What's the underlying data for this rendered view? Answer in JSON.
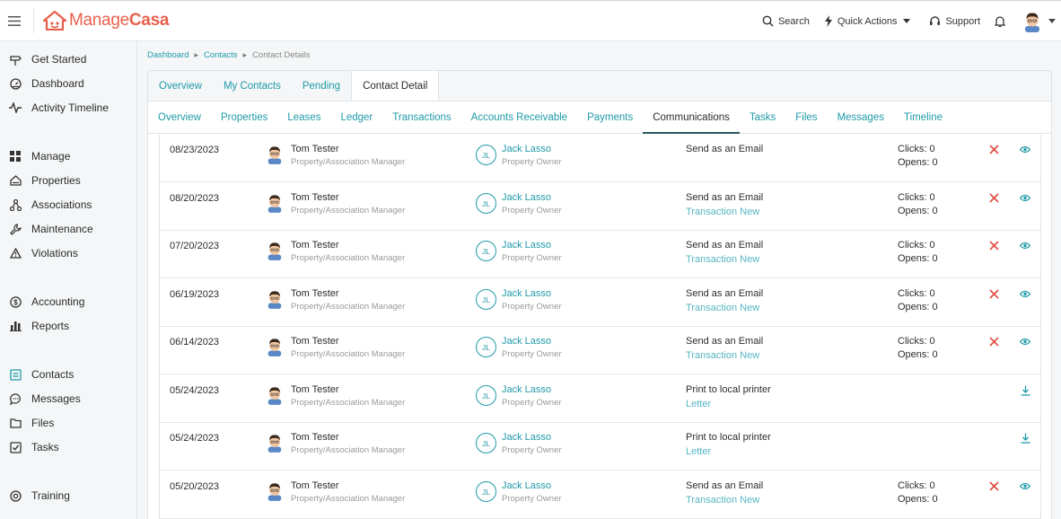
{
  "app": {
    "logo_part1": "Manage",
    "logo_part2": "Casa"
  },
  "topnav": {
    "search": "Search",
    "quick_actions": "Quick Actions",
    "support": "Support"
  },
  "sidebar": {
    "items": [
      {
        "label": "Get Started",
        "icon": "signpost-icon"
      },
      {
        "label": "Dashboard",
        "icon": "gauge-icon"
      },
      {
        "label": "Activity Timeline",
        "icon": "pulse-icon"
      },
      {
        "label": "Manage",
        "icon": "grid-icon"
      },
      {
        "label": "Properties",
        "icon": "home-icon"
      },
      {
        "label": "Associations",
        "icon": "network-icon"
      },
      {
        "label": "Maintenance",
        "icon": "wrench-icon"
      },
      {
        "label": "Violations",
        "icon": "warning-icon"
      },
      {
        "label": "Accounting",
        "icon": "dollar-icon"
      },
      {
        "label": "Reports",
        "icon": "bar-chart-icon"
      },
      {
        "label": "Contacts",
        "icon": "contacts-icon"
      },
      {
        "label": "Messages",
        "icon": "chat-icon"
      },
      {
        "label": "Files",
        "icon": "folder-icon"
      },
      {
        "label": "Tasks",
        "icon": "checkbox-icon"
      },
      {
        "label": "Training",
        "icon": "lifebuoy-icon"
      }
    ]
  },
  "breadcrumb": {
    "items": [
      "Dashboard",
      "Contacts",
      "Contact Details"
    ]
  },
  "tabs_primary": {
    "items": [
      "Overview",
      "My Contacts",
      "Pending",
      "Contact Detail"
    ],
    "active_index": 3
  },
  "tabs_secondary": {
    "items": [
      "Overview",
      "Properties",
      "Leases",
      "Ledger",
      "Transactions",
      "Accounts Receivable",
      "Payments",
      "Communications",
      "Tasks",
      "Files",
      "Messages",
      "Timeline"
    ],
    "active_index": 7
  },
  "communications": [
    {
      "date": "08/23/2023",
      "user": "Tom Tester",
      "user_role": "Property/Association Manager",
      "initials": "JL",
      "contact": "Jack Lasso",
      "contact_role": "Property Owner",
      "method": "Send as an Email",
      "subject": "",
      "clicks": "Clicks: 0",
      "opens": "Opens: 0",
      "action": "email"
    },
    {
      "date": "08/20/2023",
      "user": "Tom Tester",
      "user_role": "Property/Association Manager",
      "initials": "JL",
      "contact": "Jack Lasso",
      "contact_role": "Property Owner",
      "method": "Send as an Email",
      "subject": "Transaction New",
      "clicks": "Clicks: 0",
      "opens": "Opens: 0",
      "action": "email"
    },
    {
      "date": "07/20/2023",
      "user": "Tom Tester",
      "user_role": "Property/Association Manager",
      "initials": "JL",
      "contact": "Jack Lasso",
      "contact_role": "Property Owner",
      "method": "Send as an Email",
      "subject": "Transaction New",
      "clicks": "Clicks: 0",
      "opens": "Opens: 0",
      "action": "email"
    },
    {
      "date": "06/19/2023",
      "user": "Tom Tester",
      "user_role": "Property/Association Manager",
      "initials": "JL",
      "contact": "Jack Lasso",
      "contact_role": "Property Owner",
      "method": "Send as an Email",
      "subject": "Transaction New",
      "clicks": "Clicks: 0",
      "opens": "Opens: 0",
      "action": "email"
    },
    {
      "date": "06/14/2023",
      "user": "Tom Tester",
      "user_role": "Property/Association Manager",
      "initials": "JL",
      "contact": "Jack Lasso",
      "contact_role": "Property Owner",
      "method": "Send as an Email",
      "subject": "Transaction New",
      "clicks": "Clicks: 0",
      "opens": "Opens: 0",
      "action": "email"
    },
    {
      "date": "05/24/2023",
      "user": "Tom Tester",
      "user_role": "Property/Association Manager",
      "initials": "JL",
      "contact": "Jack Lasso",
      "contact_role": "Property Owner",
      "method": "Print to local printer",
      "subject": "Letter",
      "clicks": "",
      "opens": "",
      "action": "print"
    },
    {
      "date": "05/24/2023",
      "user": "Tom Tester",
      "user_role": "Property/Association Manager",
      "initials": "JL",
      "contact": "Jack Lasso",
      "contact_role": "Property Owner",
      "method": "Print to local printer",
      "subject": "Letter",
      "clicks": "",
      "opens": "",
      "action": "print"
    },
    {
      "date": "05/20/2023",
      "user": "Tom Tester",
      "user_role": "Property/Association Manager",
      "initials": "JL",
      "contact": "Jack Lasso",
      "contact_role": "Property Owner",
      "method": "Send as an Email",
      "subject": "Transaction New",
      "clicks": "Clicks: 0",
      "opens": "Opens: 0",
      "action": "email"
    }
  ],
  "colors": {
    "brand": "#e8604c",
    "accent": "#1f9aa8",
    "danger": "#e04a3f"
  }
}
